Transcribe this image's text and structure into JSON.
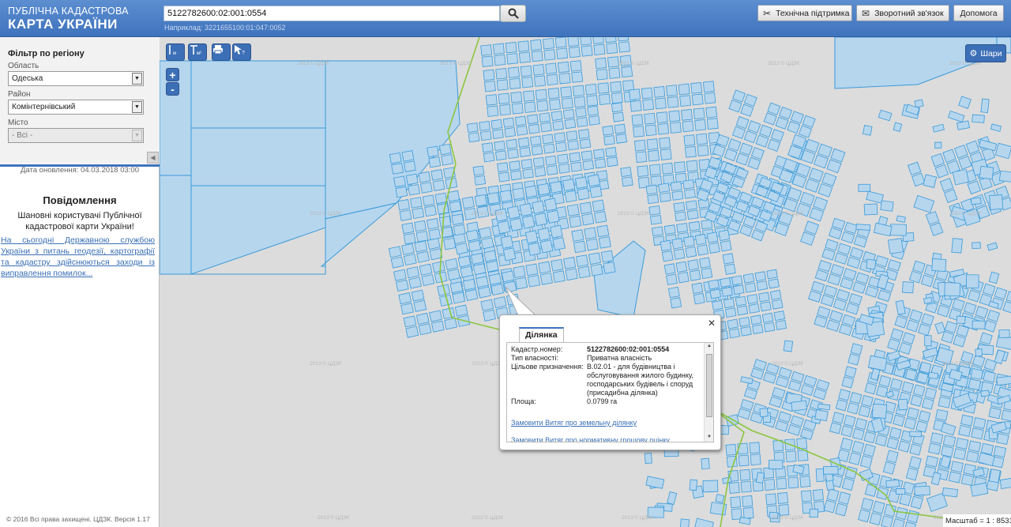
{
  "header": {
    "logo_line1": "ПУБЛІЧНА КАДАСТРОВА",
    "logo_line2": "КАРТА УКРАЇНИ",
    "search_value": "5122782600:02:001:0554",
    "search_example": "Наприклад: 3221655100:01:047:0052",
    "buttons": {
      "support": "Технічна підтримка",
      "feedback": "Зворотний зв'язок",
      "help": "Допомога"
    }
  },
  "sidebar": {
    "filter_title": "Фільтр по регіону",
    "oblast_label": "Область",
    "oblast_value": "Одеська",
    "rayon_label": "Район",
    "rayon_value": "Комінтернівський",
    "misto_label": "Місто",
    "misto_value": "- Всі -",
    "update_date": "Дата оновлення: 04.03.2018 03:00",
    "notice_title": "Повідомлення",
    "notice_greeting": "Шановні користувачі Публічної кадастрової карти України!",
    "notice_link": "На сьогодні Державною службою України з питань геодезії, картографії та кадастру здійснюються заходи із виправлення помилок...",
    "copyright": "© 2016 Всі права захищені. ЦДЗК. Версія 1.17"
  },
  "map": {
    "layers_label": "Шари",
    "scale_text": "Масштаб = 1 : 8531",
    "watermark": "2013 © ЦДЗК",
    "colors": {
      "parcel_fill": "#b6d6ee",
      "parcel_stroke": "#3a9ad9",
      "boundary": "#8cc63f",
      "background": "#dcdcdc"
    },
    "tools": [
      "measure-distance-icon",
      "measure-area-icon",
      "print-icon",
      "identify-icon"
    ]
  },
  "popup": {
    "tab": "Ділянка",
    "rows": [
      {
        "label": "Кадастр.номер:",
        "value": "5122782600:02:001:0554"
      },
      {
        "label": "Тип власності:",
        "value": "Приватна власність"
      },
      {
        "label": "Цільове призначення:",
        "value": "В.02.01 - для будівництва і обслуговування жилого будинку, господарських будівель і споруд (присадибна ділянка)"
      },
      {
        "label": "Площа:",
        "value": "0.0799 га"
      }
    ],
    "links": [
      "Замовити Витяг про земельну ділянку",
      "Замовити Витяг про нормативну грошову оцінку"
    ]
  }
}
